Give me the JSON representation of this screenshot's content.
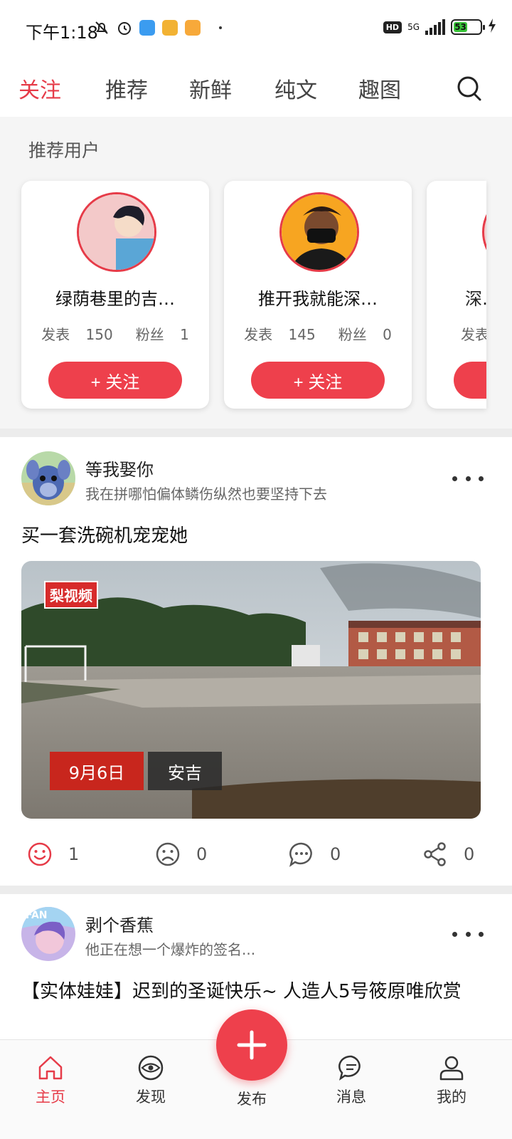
{
  "status_bar": {
    "time": "下午1:18",
    "network": "5G",
    "battery": "53",
    "hd": "HD"
  },
  "top_tabs": [
    {
      "label": "关注",
      "active": true
    },
    {
      "label": "推荐",
      "active": false
    },
    {
      "label": "新鲜",
      "active": false
    },
    {
      "label": "纯文",
      "active": false
    },
    {
      "label": "趣图",
      "active": false
    }
  ],
  "recommended": {
    "title": "推荐用户",
    "users": [
      {
        "name": "绿荫巷里的吉…",
        "posts_label": "发表",
        "posts": "150",
        "fans_label": "粉丝",
        "fans": "1",
        "follow": "+ 关注"
      },
      {
        "name": "推开我就能深…",
        "posts_label": "发表",
        "posts": "145",
        "fans_label": "粉丝",
        "fans": "0",
        "follow": "+ 关注"
      },
      {
        "name": "深…",
        "posts_label": "发表",
        "posts": "",
        "fans_label": "",
        "fans": "",
        "follow": ""
      }
    ]
  },
  "posts": [
    {
      "user": "等我娶你",
      "signature": "我在拼哪怕偏体鳞伤纵然也要坚持下去",
      "text": "买一套洗碗机宠宠她",
      "media": {
        "logo": "梨视频",
        "date": "9月6日",
        "place": "安吉"
      },
      "actions": {
        "like": "1",
        "dislike": "0",
        "comment": "0",
        "share": "0"
      }
    },
    {
      "user": "剥个香蕉",
      "signature": "他正在想一个爆炸的签名...",
      "text": "【实体娃娃】迟到的圣诞快乐~ 人造人5号筱原唯欣赏"
    }
  ],
  "bottom_nav": {
    "home": "主页",
    "discover": "发现",
    "publish": "发布",
    "messages": "消息",
    "mine": "我的"
  },
  "colors": {
    "accent": "#e63b48",
    "button": "#ee404c"
  }
}
